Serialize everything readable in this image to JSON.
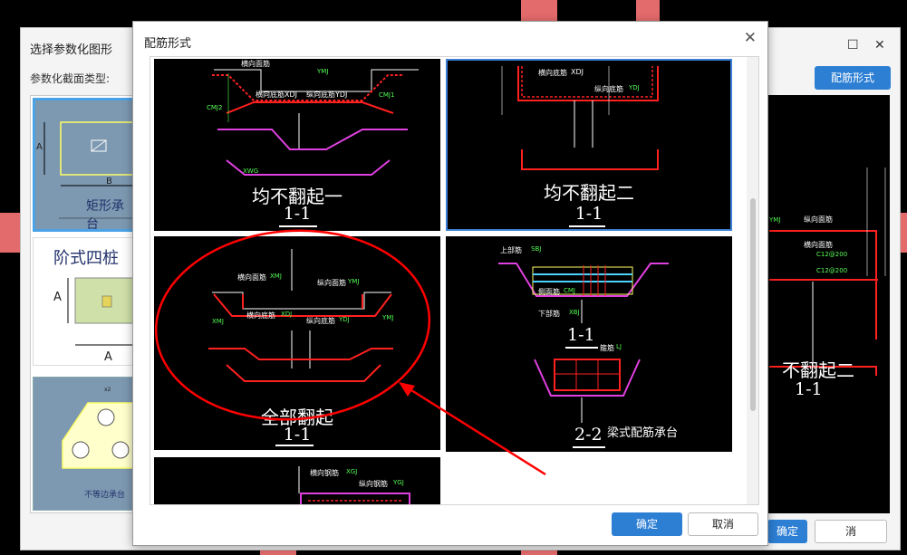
{
  "back_dialog": {
    "title": "选择参数化图形",
    "section_label": "参数化截面类型:",
    "rebar_button": "配筋形式",
    "confirm_button": "确定",
    "cancel_button": "消",
    "thumbs": [
      {
        "caption": "矩形承台",
        "dim_a": "A",
        "dim_b": "B"
      },
      {
        "caption": "阶式四桩",
        "dim_a": "A",
        "dim_b": "A"
      },
      {
        "caption": "不等边承台",
        "dim": "x2"
      }
    ],
    "preview": {
      "title": "不翻起二",
      "section": "1-1",
      "labels": [
        "纵向面筋",
        "YMJ",
        "横向面筋",
        "C12@200",
        "C12@200"
      ]
    }
  },
  "front_dialog": {
    "title": "配筋形式",
    "confirm_button": "确定",
    "cancel_button": "取消",
    "cells": [
      {
        "title": "均不翻起一",
        "section": "1-1",
        "labels": {
          "l1": "横向面筋",
          "l2": "横向底筋XDJ",
          "l3": "纵向底筋YDJ",
          "l4": "CMJ2",
          "l5": "CMJ1",
          "l6": "XWG",
          "l7": "YMJ"
        }
      },
      {
        "title": "均不翻起二",
        "section": "1-1",
        "labels": {
          "l1": "横向底筋",
          "l2": "XDJ",
          "l3": "纵向底筋",
          "l4": "YDJ"
        }
      },
      {
        "title": "全部翻起",
        "section": "1-1",
        "labels": {
          "l1": "横向面筋",
          "l2": "XMJ",
          "l3": "纵向面筋",
          "l4": "YMJ",
          "l5": "横向底筋",
          "l6": "XDJ",
          "l7": "纵向底筋",
          "l8": "YDJ",
          "l9": "XMJ",
          "l10": "YMJ"
        }
      },
      {
        "title": "梁式配筋承台",
        "section1": "1-1",
        "section2": "2-2",
        "labels": {
          "l1": "上部筋",
          "l2": "SBJ",
          "l3": "下部筋",
          "l4": "XBJ",
          "l5": "箍筋",
          "l6": "LJ",
          "l7": "侧面筋",
          "l8": "CMJ"
        }
      },
      {
        "labels": {
          "l1": "横向钢筋",
          "l2": "XGJ",
          "l3": "纵向钢筋",
          "l4": "YGJ"
        }
      }
    ]
  },
  "colors": {
    "accent": "#2d7fd4",
    "selection": "#3b7fd6",
    "annotation_red": "#ff0000",
    "rebar_red": "#ff2020",
    "rebar_magenta": "#e040e0",
    "rebar_green": "#55ff55"
  }
}
